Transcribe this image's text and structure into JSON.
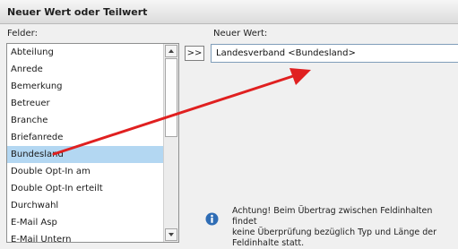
{
  "window": {
    "title": "Neuer Wert oder Teilwert"
  },
  "fields_panel": {
    "label": "Felder:",
    "items": [
      "Abteilung",
      "Anrede",
      "Bemerkung",
      "Betreuer",
      "Branche",
      "Briefanrede",
      "Bundesland",
      "Double Opt-In am",
      "Double Opt-In erteilt",
      "Durchwahl",
      "E-Mail Asp",
      "E-Mail Untern"
    ],
    "selected": "Bundesland"
  },
  "transfer_button": {
    "label": ">>"
  },
  "new_value": {
    "label": "Neuer Wert:",
    "value": "Landesverband <Bundesland>"
  },
  "info": {
    "icon": "info-icon",
    "line1": "Achtung! Beim Übertrag zwischen Feldinhalten findet",
    "line2": "keine Überprüfung bezüglich Typ und Länge der",
    "line3": "Feldinhalte statt."
  },
  "colors": {
    "selection": "#b3d7f2",
    "annotation_arrow": "#e02020",
    "info_icon": "#2f6db5"
  }
}
